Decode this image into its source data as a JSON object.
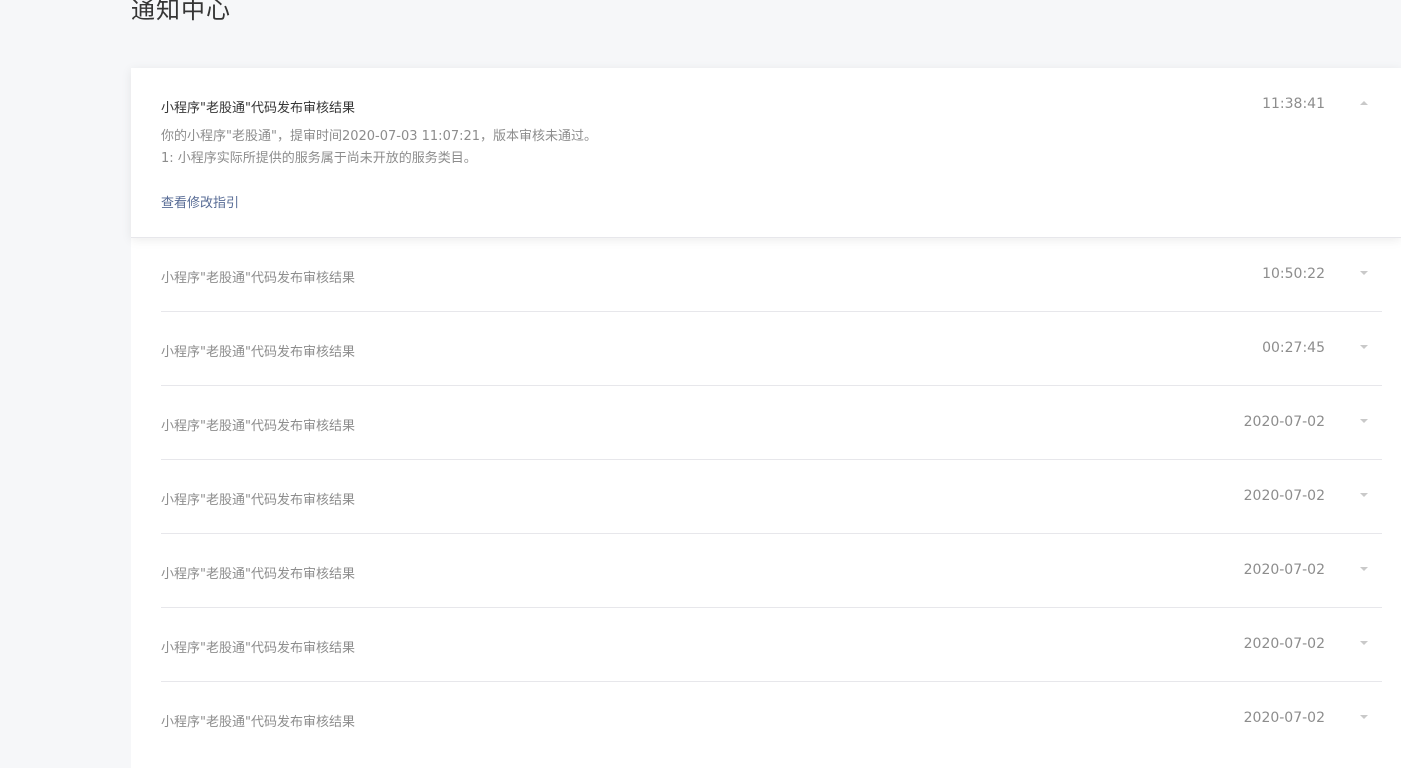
{
  "page": {
    "title": "通知中心"
  },
  "expanded_item": {
    "title": "小程序\"老股通\"代码发布审核结果",
    "time": "11:38:41",
    "body_line1": "你的小程序\"老股通\"，提审时间2020-07-03 11:07:21，版本审核未通过。",
    "body_line2": "1: 小程序实际所提供的服务属于尚未开放的服务类目。",
    "link_label": "查看修改指引",
    "toggle_icon": "chevron-up-icon"
  },
  "items": [
    {
      "title": "小程序\"老股通\"代码发布审核结果",
      "time": "10:50:22"
    },
    {
      "title": "小程序\"老股通\"代码发布审核结果",
      "time": "00:27:45"
    },
    {
      "title": "小程序\"老股通\"代码发布审核结果",
      "time": "2020-07-02"
    },
    {
      "title": "小程序\"老股通\"代码发布审核结果",
      "time": "2020-07-02"
    },
    {
      "title": "小程序\"老股通\"代码发布审核结果",
      "time": "2020-07-02"
    },
    {
      "title": "小程序\"老股通\"代码发布审核结果",
      "time": "2020-07-02"
    },
    {
      "title": "小程序\"老股通\"代码发布审核结果",
      "time": "2020-07-02"
    }
  ],
  "colors": {
    "link": "#576b95",
    "muted": "#8d8d8d",
    "text": "#353535",
    "divider": "#e7e7eb"
  }
}
